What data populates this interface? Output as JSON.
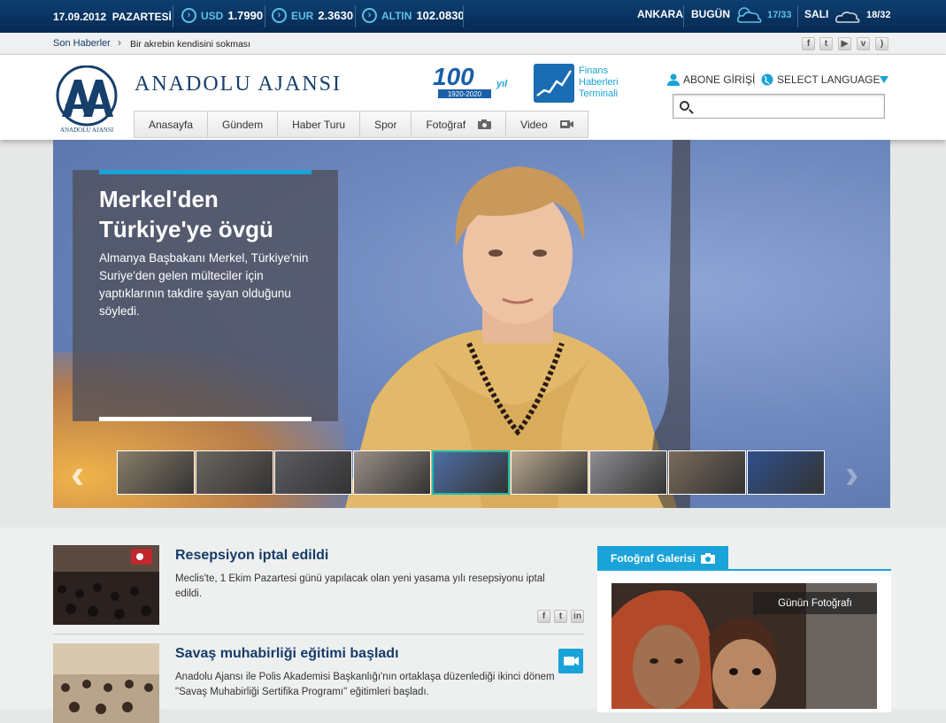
{
  "topbar": {
    "date": "17.09.2012",
    "day": "PAZARTESİ",
    "currencies": [
      {
        "label": "USD",
        "value": "1.7990"
      },
      {
        "label": "EUR",
        "value": "2.3630"
      },
      {
        "label": "ALTIN",
        "value": "102.0830"
      }
    ],
    "weather": {
      "city": "ANKARA",
      "today_label": "BUGÜN",
      "today_temp": "17/33",
      "next_day": "SALI",
      "next_temp": "18/32"
    }
  },
  "ticker": {
    "label": "Son Haberler",
    "chevron": "›",
    "headline": "Bir akrebin kendisini sokması"
  },
  "social_top": [
    "f",
    "t",
    "y",
    "v",
    "rss"
  ],
  "header": {
    "brand": "ANADOLU AJANSI",
    "logo_text": "ANADOLU AJANSI",
    "anniversary_main": "100",
    "anniversary_suffix": "yıl",
    "anniversary_years": "1920-2020",
    "finance_lines": [
      "Finans",
      "Haberleri",
      "Terminali"
    ],
    "abone": "ABONE GİRİŞİ",
    "language": "SELECT LANGUAGE",
    "search_placeholder": ""
  },
  "nav": [
    {
      "label": "Anasayfa"
    },
    {
      "label": "Gündem"
    },
    {
      "label": "Haber Turu"
    },
    {
      "label": "Spor"
    },
    {
      "label": "Fotoğraf"
    },
    {
      "label": "Video"
    }
  ],
  "slider": {
    "title": "Merkel'den Türkiye'ye övgü",
    "summary": "Almanya Başbakanı Merkel, Türkiye'nin Suriye'den gelen mülteciler için yaptıklarının takdire şayan olduğunu söyledi.",
    "prev": "‹",
    "next": "›",
    "thumb_colors": [
      "#8a7f6a",
      "#6b6660",
      "#5c5d63",
      "#9a8f86",
      "#4e6fa6",
      "#b9a88f",
      "#8d8e92",
      "#7a6a5a",
      "#2f4f8a"
    ]
  },
  "news": [
    {
      "title": "Resepsiyon iptal edildi",
      "summary": "Meclis'te, 1 Ekim Pazartesi günü yapılacak olan yeni yasama yılı resepsiyonu iptal edildi.",
      "share": [
        "f",
        "t",
        "in"
      ]
    },
    {
      "title": "Savaş muhabirliği eğitimi başladı",
      "summary": "Anadolu Ajansı ile Polis Akademisi Başkanlığı'nın ortaklaşa düzenlediği ikinci dönem \"Savaş Muhabirliği Sertifika Programı\" eğitimleri başladı."
    }
  ],
  "gallery": {
    "tab": "Fotoğraf Galerisi",
    "label": "Günün Fotoğrafı"
  },
  "colors": {
    "accent": "#19a3d9",
    "navy": "#163b68",
    "topbar": "#062a52"
  }
}
